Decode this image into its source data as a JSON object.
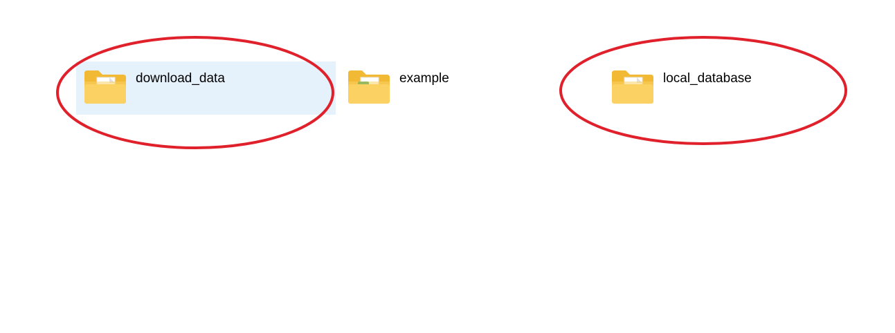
{
  "files": [
    {
      "id": "download",
      "name": "download_data",
      "icon": "folder-icon",
      "selected": true,
      "circled": true
    },
    {
      "id": "example",
      "name": "example",
      "icon": "folder-spreadsheet-icon",
      "selected": false,
      "circled": false
    },
    {
      "id": "local",
      "name": "local_database",
      "icon": "folder-icon",
      "selected": false,
      "circled": true
    }
  ],
  "colors": {
    "selection_background": "#e5f1fb",
    "annotation_ellipse": "#e0202a",
    "folder_back": "#f2b935",
    "folder_front": "#fbd163",
    "spreadsheet_badge": "#1f9d55"
  }
}
